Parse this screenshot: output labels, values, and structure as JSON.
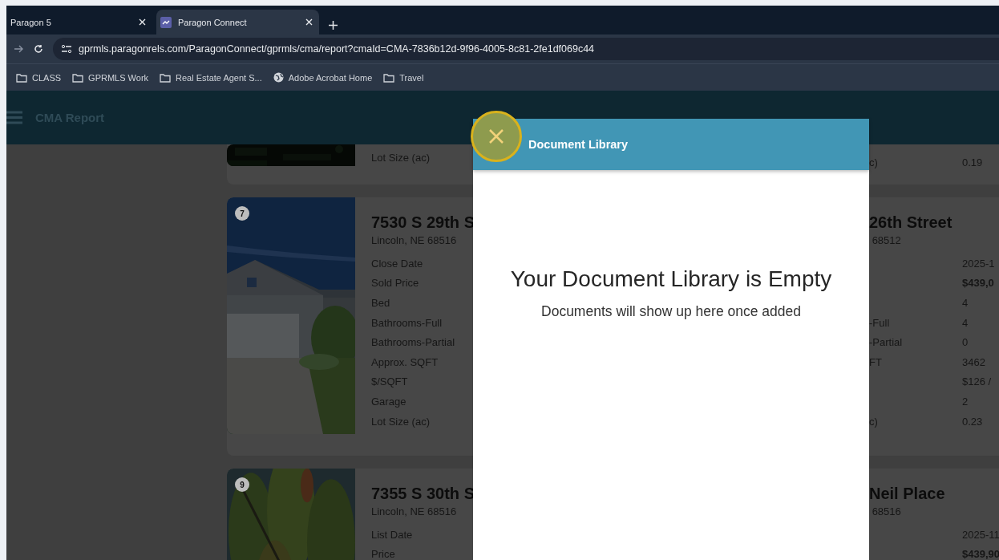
{
  "browser": {
    "tabs": [
      {
        "title": "Paragon 5",
        "selected": false
      },
      {
        "title": "Paragon Connect",
        "selected": true
      }
    ],
    "url": "gprmls.paragonrels.com/ParagonConnect/gprmls/cma/report?cmaId=CMA-7836b12d-9f96-4005-8c81-2fe1df069c44",
    "bookmarks": [
      {
        "label": "CLASS",
        "kind": "folder"
      },
      {
        "label": "GPRMLS Work",
        "kind": "folder"
      },
      {
        "label": "Real Estate Agent S...",
        "kind": "folder"
      },
      {
        "label": "Adobe Acrobat Home",
        "kind": "globe"
      },
      {
        "label": "Travel",
        "kind": "folder"
      }
    ]
  },
  "app_header": {
    "title": "CMA Report"
  },
  "comparables": [
    {
      "left": {
        "kind": "partial",
        "rows": [
          {
            "label": "Lot Size (ac)"
          }
        ]
      },
      "right": {
        "rows": [
          {
            "label": "c)",
            "value": "0.19",
            "emphasis": false
          }
        ]
      }
    },
    {
      "left": {
        "kind": "full",
        "badge": "7",
        "title": "7530 S 29th S",
        "subtitle": "Lincoln, NE 68516",
        "rows": [
          {
            "label": "Close Date"
          },
          {
            "label": "Sold Price"
          },
          {
            "label": "Bed"
          },
          {
            "label": "Bathrooms-Full"
          },
          {
            "label": "Bathrooms-Partial"
          },
          {
            "label": "Approx. SQFT"
          },
          {
            "label": "$/SQFT"
          },
          {
            "label": "Garage"
          },
          {
            "label": "Lot Size (ac)"
          }
        ]
      },
      "right": {
        "title": "26th Street",
        "subtitle": "68512",
        "rows": [
          {
            "value": "2025-1",
            "emphasis": false
          },
          {
            "value": "$439,0",
            "emphasis": true
          },
          {
            "value": "4",
            "emphasis": false
          },
          {
            "label": "-Full",
            "value": "4",
            "emphasis": false
          },
          {
            "label": "-Partial",
            "value": "0",
            "emphasis": false
          },
          {
            "label": "FT",
            "value": "3462",
            "emphasis": false
          },
          {
            "value": "$126 /",
            "emphasis": false
          },
          {
            "value": "2",
            "emphasis": false
          },
          {
            "label": "c)",
            "value": "0.23",
            "emphasis": false
          }
        ]
      }
    },
    {
      "left": {
        "kind": "full",
        "badge": "9",
        "title": "7355 S 30th S",
        "subtitle": "Lincoln, NE 68516",
        "rows": [
          {
            "label": "List Date"
          },
          {
            "label": "Price"
          }
        ]
      },
      "right": {
        "title": "Neil Place",
        "subtitle": "68516",
        "rows": [
          {
            "value": "2025-11",
            "emphasis": false
          },
          {
            "value": "$439,90",
            "emphasis": true
          }
        ]
      }
    }
  ],
  "modal": {
    "title": "Document Library",
    "heading": "Your Document Library is Empty",
    "message": "Documents will show up here once added"
  }
}
